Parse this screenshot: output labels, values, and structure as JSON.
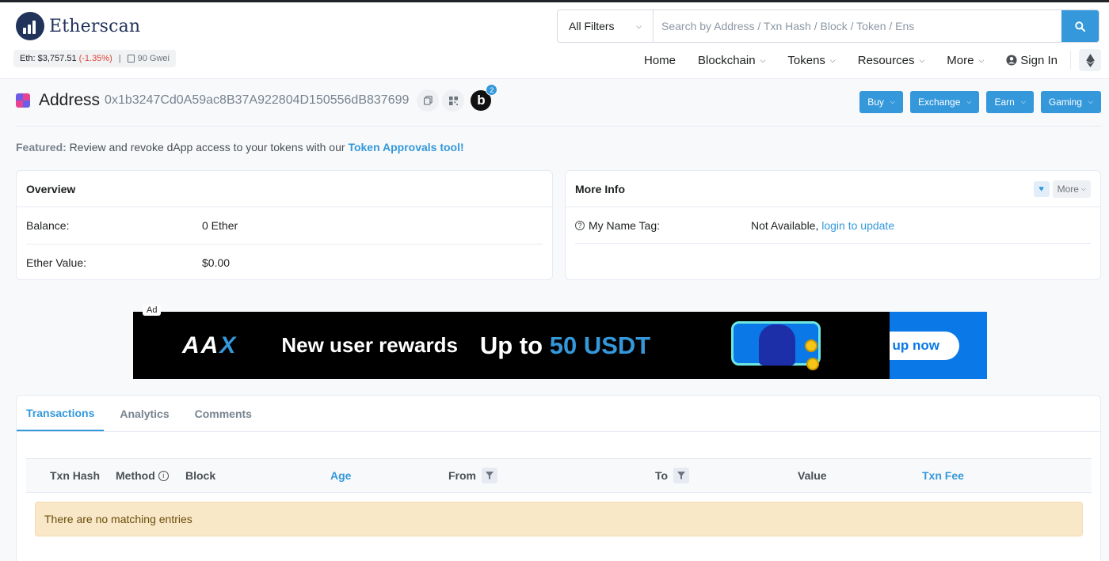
{
  "brand": {
    "name": "Etherscan"
  },
  "price_bar": {
    "eth_price": "Eth: $3,757.51",
    "change": "(-1.35%)",
    "separator": "|",
    "gas": "90 Gwei"
  },
  "search": {
    "filter_label": "All Filters",
    "placeholder": "Search by Address / Txn Hash / Block / Token / Ens"
  },
  "nav": {
    "items": [
      "Home",
      "Blockchain",
      "Tokens",
      "Resources",
      "More"
    ],
    "sign_in": "Sign In"
  },
  "address": {
    "label": "Address",
    "hash": "0x1b3247Cd0A59ac8B37A922804D150556dB837699",
    "badge_letter": "b",
    "badge_count": "2"
  },
  "actions": [
    "Buy",
    "Exchange",
    "Earn",
    "Gaming"
  ],
  "featured": {
    "prefix": "Featured:",
    "text": " Review and revoke dApp access to your tokens with our ",
    "link": "Token Approvals tool!"
  },
  "overview": {
    "title": "Overview",
    "rows": [
      {
        "key": "Balance:",
        "value": "0 Ether"
      },
      {
        "key": "Ether Value:",
        "value": "$0.00"
      }
    ]
  },
  "more_info": {
    "title": "More Info",
    "more_label": "More",
    "name_tag_key": "My Name Tag:",
    "name_tag_value": "Not Available, ",
    "name_tag_link": "login to update"
  },
  "ad": {
    "tag": "Ad",
    "logo_main": "AA",
    "logo_x": "X",
    "line1": "New user rewards",
    "line2_prefix": "Up to ",
    "line2_amount": "50 USDT",
    "cta": "Sign up now"
  },
  "tabs": [
    "Transactions",
    "Analytics",
    "Comments"
  ],
  "table": {
    "headers": [
      "Txn Hash",
      "Method",
      "Block",
      "Age",
      "From",
      "To",
      "Value",
      "Txn Fee"
    ],
    "empty_message": "There are no matching entries"
  },
  "colors": {
    "accent": "#3498db",
    "negative": "#de4437",
    "warning_bg": "#f8e8c8"
  }
}
